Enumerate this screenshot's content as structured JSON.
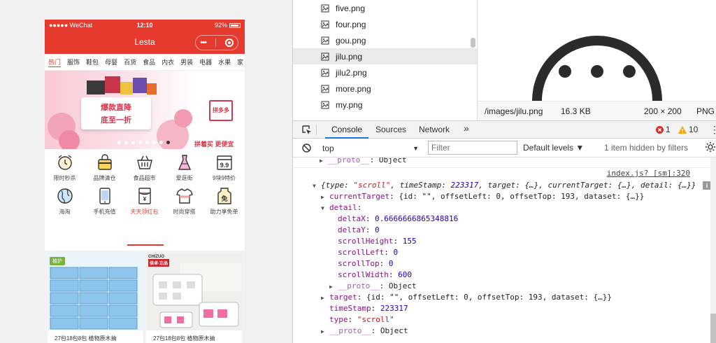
{
  "phone": {
    "status": {
      "carrier": "●●●●● WeChat",
      "time": "12:10",
      "battery": "92%"
    },
    "title": "Lesta",
    "capsule_more": "•••",
    "categories": [
      "热门",
      "服饰",
      "鞋包",
      "母婴",
      "百货",
      "食品",
      "内衣",
      "男装",
      "电器",
      "水果",
      "家"
    ],
    "banner": {
      "line1": "爆款直降",
      "line2": "底至一折",
      "logo": "拼多多",
      "slogan": "拼着买 更便宜"
    },
    "icons_row1": [
      {
        "label": "限时秒杀",
        "icon": "alarm-clock-icon"
      },
      {
        "label": "品牌清仓",
        "icon": "bag-icon"
      },
      {
        "label": "食品超市",
        "icon": "basket-icon"
      },
      {
        "label": "爱逛街",
        "icon": "dress-icon"
      },
      {
        "label": "9块9特价",
        "icon": "calendar-99-icon"
      }
    ],
    "icons_row2": [
      {
        "label": "海淘",
        "icon": "globe-icon"
      },
      {
        "label": "手机充值",
        "icon": "phone-icon"
      },
      {
        "label": "天天领红包",
        "icon": "red-envelope-icon"
      },
      {
        "label": "时尚穿搭",
        "icon": "tshirt-icon"
      },
      {
        "label": "助力享免单",
        "icon": "free-tag-icon"
      }
    ],
    "red_envelope_char": "¥",
    "free_char": "免",
    "calendar_text": "9.9",
    "products": [
      {
        "name": "27包18包8包 植物原木抽",
        "tag": "植护"
      },
      {
        "name": "27包18包8包 植物原木抽",
        "tag": "CHIZUO",
        "tag_sub": "倍卓·正品"
      }
    ]
  },
  "devtools": {
    "files": [
      "five.png",
      "four.png",
      "gou.png",
      "jilu.png",
      "jilu2.png",
      "more.png",
      "my.png"
    ],
    "selected_file": "jilu.png",
    "preview": {
      "path": "/images/jilu.png",
      "size": "16.3 KB",
      "dimensions": "200 × 200",
      "type": "PNG"
    },
    "tabs": [
      "Console",
      "Sources",
      "Network"
    ],
    "tab_overflow": "»",
    "errors": "1",
    "warnings": "10",
    "context": "top",
    "filter_placeholder": "Filter",
    "levels": "Default levels ▼",
    "hidden": "1 item hidden by filters",
    "source_link": "index.js? [sm]:320",
    "lines": {
      "proto_top": "__proto__",
      "proto_top_val": ": Object",
      "event_summary_open": "{",
      "event_type_key": "type",
      "event_type_val": "\"scroll\"",
      "event_rest_1": ", timeStamp: ",
      "event_ts_val": "223317",
      "event_rest_2": ", target: {…}, currentTarget: {…}, detail: {…}}",
      "current_target_key": "currentTarget",
      "current_target_val": ": {id: \"\", offsetLeft: 0, offsetTop: 193, dataset: {…}}",
      "detail_key": "detail",
      "detail_colon": ":",
      "deltaX_key": "deltaX",
      "deltaX_val": "0.6666666865348816",
      "deltaY_key": "deltaY",
      "deltaY_val": "0",
      "scrollHeight_key": "scrollHeight",
      "scrollHeight_val": "155",
      "scrollLeft_key": "scrollLeft",
      "scrollLeft_val": "0",
      "scrollTop_key": "scrollTop",
      "scrollTop_val": "0",
      "scrollWidth_key": "scrollWidth",
      "scrollWidth_val": "600",
      "proto_detail": "__proto__",
      "proto_detail_val": ": Object",
      "target_key": "target",
      "target_val": ": {id: \"\", offsetLeft: 0, offsetTop: 193, dataset: {…}}",
      "timeStamp_key": "timeStamp",
      "timeStamp_val": "223317",
      "type_key": "type",
      "type_val": "\"scroll\"",
      "proto_bottom": "__proto__",
      "proto_bottom_val": ": Object"
    }
  },
  "colors": {
    "brand_red": "#e63a2e",
    "link_blue": "#1a73e8",
    "error_red": "#d93025",
    "warning_yellow": "#f2a600"
  }
}
